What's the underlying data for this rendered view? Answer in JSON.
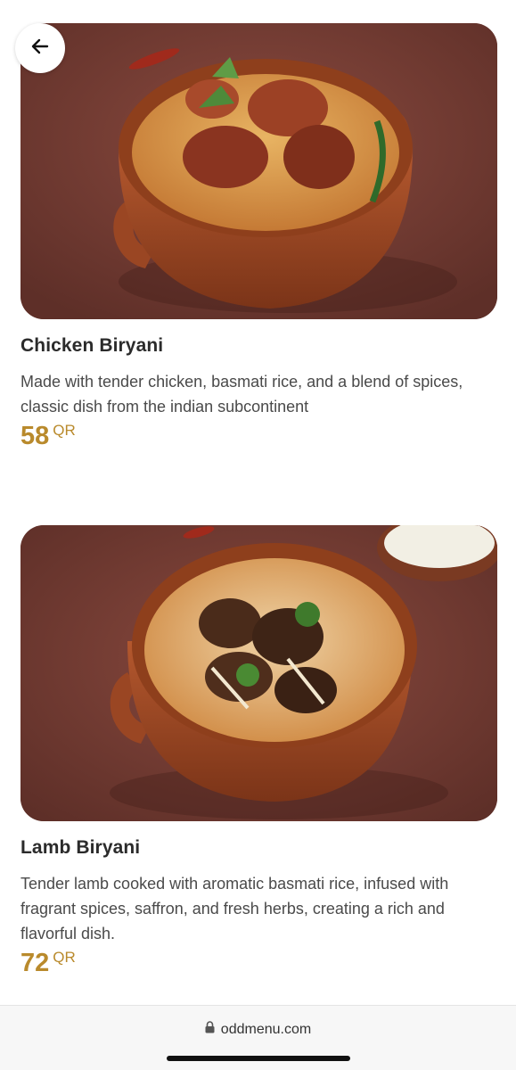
{
  "nav": {
    "back_icon": "arrow-left-icon"
  },
  "items": [
    {
      "name": "Chicken Biryani",
      "description": "Made with tender chicken, basmati rice, and a blend of spices, classic dish from the indian subcontinent",
      "price": "58",
      "currency": "QR",
      "image_icon": "chicken-biryani-photo"
    },
    {
      "name": "Lamb Biryani",
      "description": "Tender lamb cooked with aromatic basmati rice, infused with fragrant spices, saffron, and fresh herbs, creating a rich and flavorful dish.",
      "price": "72",
      "currency": "QR",
      "image_icon": "lamb-biryani-photo"
    }
  ],
  "browser": {
    "url": "oddmenu.com",
    "lock_icon": "lock-icon"
  },
  "colors": {
    "price": "#b98a2c",
    "title": "#2b2b2b",
    "description": "#4a4a4a"
  }
}
